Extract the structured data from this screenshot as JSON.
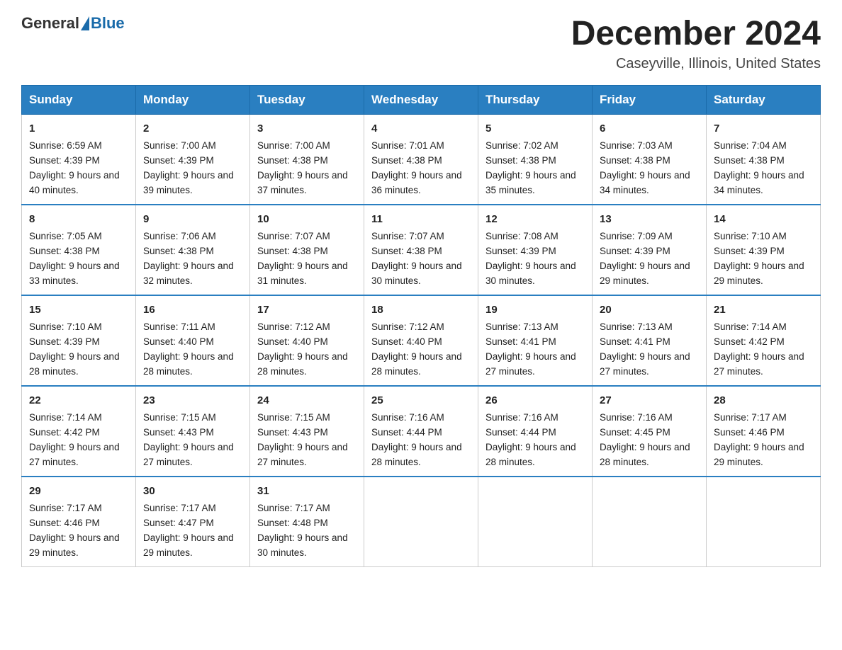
{
  "header": {
    "logo_general": "General",
    "logo_blue": "Blue",
    "month_title": "December 2024",
    "location": "Caseyville, Illinois, United States"
  },
  "days_of_week": [
    "Sunday",
    "Monday",
    "Tuesday",
    "Wednesday",
    "Thursday",
    "Friday",
    "Saturday"
  ],
  "weeks": [
    [
      {
        "day": "1",
        "sunrise": "Sunrise: 6:59 AM",
        "sunset": "Sunset: 4:39 PM",
        "daylight": "Daylight: 9 hours and 40 minutes."
      },
      {
        "day": "2",
        "sunrise": "Sunrise: 7:00 AM",
        "sunset": "Sunset: 4:39 PM",
        "daylight": "Daylight: 9 hours and 39 minutes."
      },
      {
        "day": "3",
        "sunrise": "Sunrise: 7:00 AM",
        "sunset": "Sunset: 4:38 PM",
        "daylight": "Daylight: 9 hours and 37 minutes."
      },
      {
        "day": "4",
        "sunrise": "Sunrise: 7:01 AM",
        "sunset": "Sunset: 4:38 PM",
        "daylight": "Daylight: 9 hours and 36 minutes."
      },
      {
        "day": "5",
        "sunrise": "Sunrise: 7:02 AM",
        "sunset": "Sunset: 4:38 PM",
        "daylight": "Daylight: 9 hours and 35 minutes."
      },
      {
        "day": "6",
        "sunrise": "Sunrise: 7:03 AM",
        "sunset": "Sunset: 4:38 PM",
        "daylight": "Daylight: 9 hours and 34 minutes."
      },
      {
        "day": "7",
        "sunrise": "Sunrise: 7:04 AM",
        "sunset": "Sunset: 4:38 PM",
        "daylight": "Daylight: 9 hours and 34 minutes."
      }
    ],
    [
      {
        "day": "8",
        "sunrise": "Sunrise: 7:05 AM",
        "sunset": "Sunset: 4:38 PM",
        "daylight": "Daylight: 9 hours and 33 minutes."
      },
      {
        "day": "9",
        "sunrise": "Sunrise: 7:06 AM",
        "sunset": "Sunset: 4:38 PM",
        "daylight": "Daylight: 9 hours and 32 minutes."
      },
      {
        "day": "10",
        "sunrise": "Sunrise: 7:07 AM",
        "sunset": "Sunset: 4:38 PM",
        "daylight": "Daylight: 9 hours and 31 minutes."
      },
      {
        "day": "11",
        "sunrise": "Sunrise: 7:07 AM",
        "sunset": "Sunset: 4:38 PM",
        "daylight": "Daylight: 9 hours and 30 minutes."
      },
      {
        "day": "12",
        "sunrise": "Sunrise: 7:08 AM",
        "sunset": "Sunset: 4:39 PM",
        "daylight": "Daylight: 9 hours and 30 minutes."
      },
      {
        "day": "13",
        "sunrise": "Sunrise: 7:09 AM",
        "sunset": "Sunset: 4:39 PM",
        "daylight": "Daylight: 9 hours and 29 minutes."
      },
      {
        "day": "14",
        "sunrise": "Sunrise: 7:10 AM",
        "sunset": "Sunset: 4:39 PM",
        "daylight": "Daylight: 9 hours and 29 minutes."
      }
    ],
    [
      {
        "day": "15",
        "sunrise": "Sunrise: 7:10 AM",
        "sunset": "Sunset: 4:39 PM",
        "daylight": "Daylight: 9 hours and 28 minutes."
      },
      {
        "day": "16",
        "sunrise": "Sunrise: 7:11 AM",
        "sunset": "Sunset: 4:40 PM",
        "daylight": "Daylight: 9 hours and 28 minutes."
      },
      {
        "day": "17",
        "sunrise": "Sunrise: 7:12 AM",
        "sunset": "Sunset: 4:40 PM",
        "daylight": "Daylight: 9 hours and 28 minutes."
      },
      {
        "day": "18",
        "sunrise": "Sunrise: 7:12 AM",
        "sunset": "Sunset: 4:40 PM",
        "daylight": "Daylight: 9 hours and 28 minutes."
      },
      {
        "day": "19",
        "sunrise": "Sunrise: 7:13 AM",
        "sunset": "Sunset: 4:41 PM",
        "daylight": "Daylight: 9 hours and 27 minutes."
      },
      {
        "day": "20",
        "sunrise": "Sunrise: 7:13 AM",
        "sunset": "Sunset: 4:41 PM",
        "daylight": "Daylight: 9 hours and 27 minutes."
      },
      {
        "day": "21",
        "sunrise": "Sunrise: 7:14 AM",
        "sunset": "Sunset: 4:42 PM",
        "daylight": "Daylight: 9 hours and 27 minutes."
      }
    ],
    [
      {
        "day": "22",
        "sunrise": "Sunrise: 7:14 AM",
        "sunset": "Sunset: 4:42 PM",
        "daylight": "Daylight: 9 hours and 27 minutes."
      },
      {
        "day": "23",
        "sunrise": "Sunrise: 7:15 AM",
        "sunset": "Sunset: 4:43 PM",
        "daylight": "Daylight: 9 hours and 27 minutes."
      },
      {
        "day": "24",
        "sunrise": "Sunrise: 7:15 AM",
        "sunset": "Sunset: 4:43 PM",
        "daylight": "Daylight: 9 hours and 27 minutes."
      },
      {
        "day": "25",
        "sunrise": "Sunrise: 7:16 AM",
        "sunset": "Sunset: 4:44 PM",
        "daylight": "Daylight: 9 hours and 28 minutes."
      },
      {
        "day": "26",
        "sunrise": "Sunrise: 7:16 AM",
        "sunset": "Sunset: 4:44 PM",
        "daylight": "Daylight: 9 hours and 28 minutes."
      },
      {
        "day": "27",
        "sunrise": "Sunrise: 7:16 AM",
        "sunset": "Sunset: 4:45 PM",
        "daylight": "Daylight: 9 hours and 28 minutes."
      },
      {
        "day": "28",
        "sunrise": "Sunrise: 7:17 AM",
        "sunset": "Sunset: 4:46 PM",
        "daylight": "Daylight: 9 hours and 29 minutes."
      }
    ],
    [
      {
        "day": "29",
        "sunrise": "Sunrise: 7:17 AM",
        "sunset": "Sunset: 4:46 PM",
        "daylight": "Daylight: 9 hours and 29 minutes."
      },
      {
        "day": "30",
        "sunrise": "Sunrise: 7:17 AM",
        "sunset": "Sunset: 4:47 PM",
        "daylight": "Daylight: 9 hours and 29 minutes."
      },
      {
        "day": "31",
        "sunrise": "Sunrise: 7:17 AM",
        "sunset": "Sunset: 4:48 PM",
        "daylight": "Daylight: 9 hours and 30 minutes."
      },
      null,
      null,
      null,
      null
    ]
  ]
}
